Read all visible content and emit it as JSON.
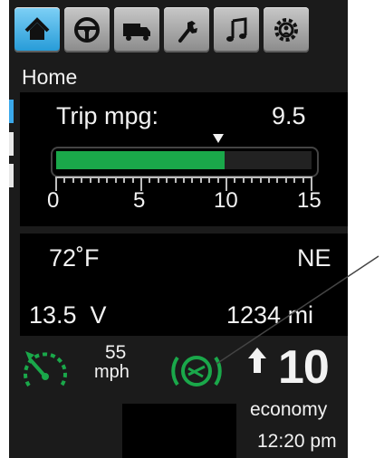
{
  "tabs": [
    {
      "label": "",
      "icon": "home-icon",
      "active": true
    },
    {
      "label": "",
      "icon": "steering-wheel-icon",
      "active": false
    },
    {
      "label": "",
      "icon": "truck-icon",
      "active": false
    },
    {
      "label": "",
      "icon": "wrench-icon",
      "active": false
    },
    {
      "label": "",
      "icon": "music-note-icon",
      "active": false
    },
    {
      "label": "",
      "icon": "settings-gear-icon",
      "active": false
    }
  ],
  "page_title": "Home",
  "trip": {
    "label": "Trip mpg:",
    "value": "9.5",
    "gauge_fill_fraction": 0.66,
    "marker_value": 9.5,
    "scale_min": 0,
    "scale_max": 15,
    "scale_labels": [
      "0",
      "5",
      "10",
      "15"
    ]
  },
  "climate": {
    "temperature": "72˚F",
    "heading": "NE",
    "voltage": "13.5  V",
    "odometer": "1234 mi"
  },
  "status": {
    "speed_value": "55",
    "speed_unit": "mph",
    "gear": "10",
    "mode": "economy",
    "clock": "12:20 pm"
  },
  "colors": {
    "accent_tab": "#4bb6e8",
    "gauge_fill": "#1aa84a",
    "indicator": "#1aa84a",
    "background": "#1b1b1b"
  }
}
